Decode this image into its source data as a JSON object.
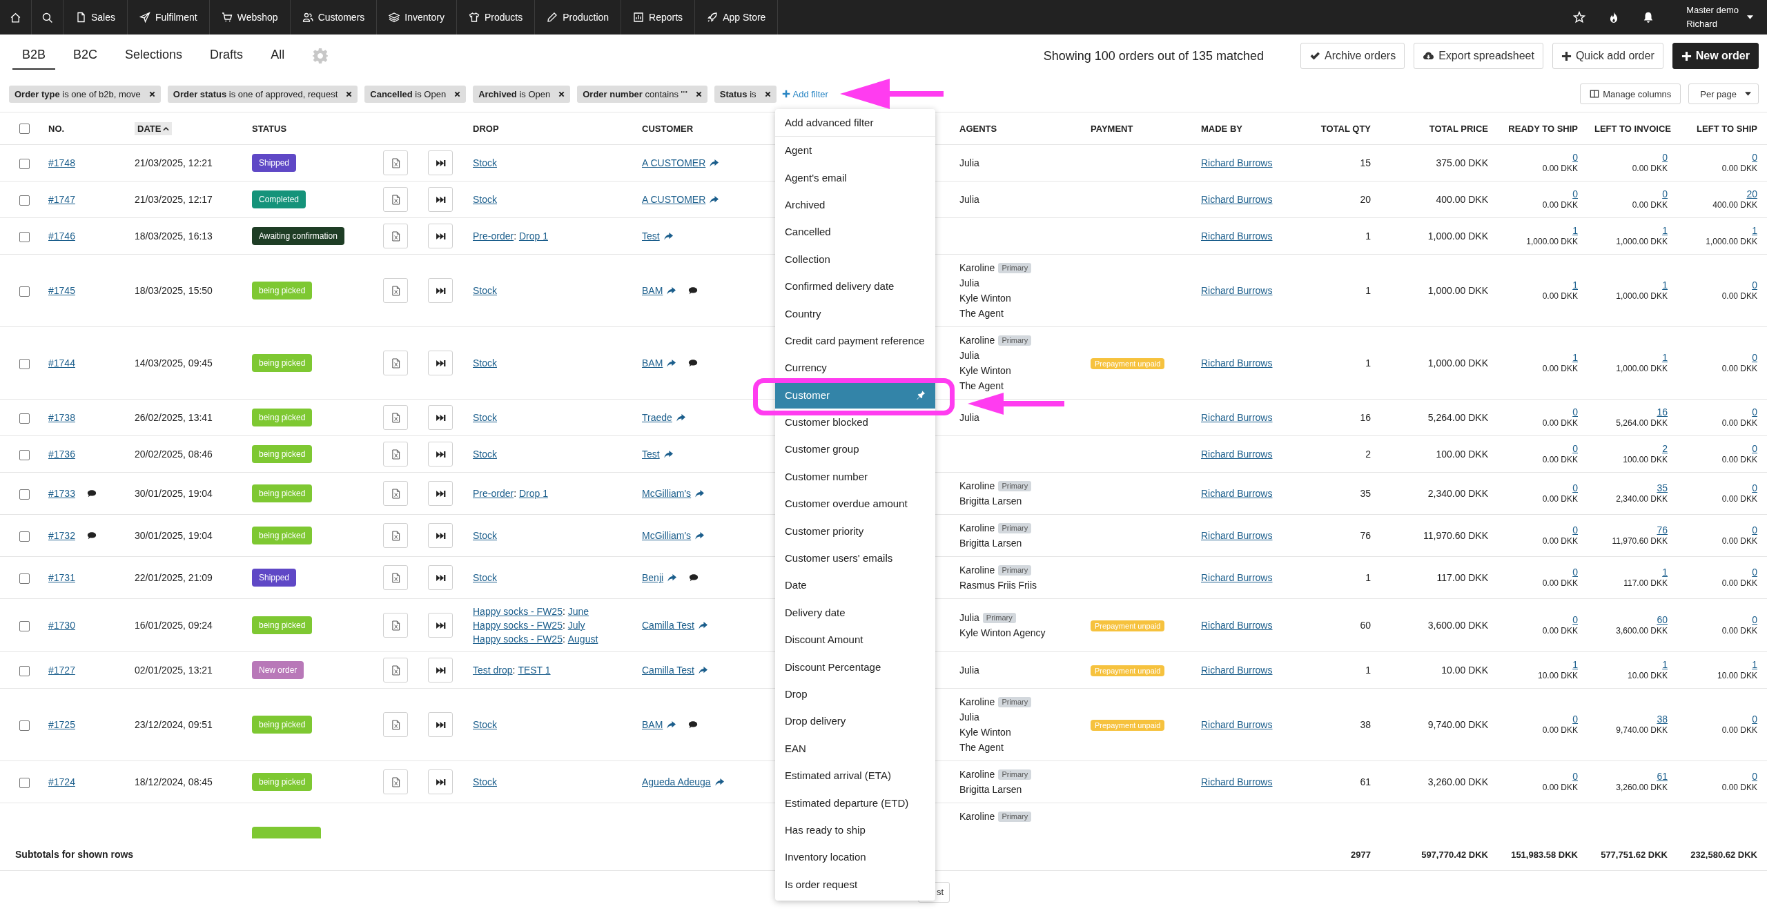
{
  "nav": {
    "items": [
      {
        "label": "Sales"
      },
      {
        "label": "Fulfilment"
      },
      {
        "label": "Webshop"
      },
      {
        "label": "Customers"
      },
      {
        "label": "Inventory"
      },
      {
        "label": "Products"
      },
      {
        "label": "Production"
      },
      {
        "label": "Reports"
      },
      {
        "label": "App Store"
      }
    ],
    "user": {
      "account": "Master demo",
      "name": "Richard"
    }
  },
  "tabs": [
    {
      "label": "B2B",
      "selected": true
    },
    {
      "label": "B2C",
      "selected": false
    },
    {
      "label": "Selections",
      "selected": false
    },
    {
      "label": "Drafts",
      "selected": false
    },
    {
      "label": "All",
      "selected": false
    }
  ],
  "summary": "Showing 100 orders out of 135 matched",
  "actions": [
    {
      "label": "Archive orders",
      "kind": "archive"
    },
    {
      "label": "Export spreadsheet",
      "kind": "export"
    },
    {
      "label": "Quick add order",
      "kind": "quick"
    },
    {
      "label": "New order",
      "kind": "new"
    }
  ],
  "filters": [
    {
      "text": "**Order type** is one of b2b, move"
    },
    {
      "text": "**Order status** is one of approved, request"
    },
    {
      "text": "**Cancelled** is Open"
    },
    {
      "text": "**Archived** is Open"
    },
    {
      "text": "**Order number** contains \"\""
    },
    {
      "text": "**Status** is"
    }
  ],
  "add_filter": "Add filter",
  "manage_columns": "Manage columns",
  "per_page": "Per page",
  "filter_menu": {
    "header": "Add advanced filter",
    "items": [
      {
        "label": "Agent",
        "selected": false
      },
      {
        "label": "Agent's email",
        "selected": false
      },
      {
        "label": "Archived",
        "selected": false
      },
      {
        "label": "Cancelled",
        "selected": false
      },
      {
        "label": "Collection",
        "selected": false
      },
      {
        "label": "Confirmed delivery date",
        "selected": false
      },
      {
        "label": "Country",
        "selected": false
      },
      {
        "label": "Credit card payment reference",
        "selected": false
      },
      {
        "label": "Currency",
        "selected": false
      },
      {
        "label": "Customer",
        "selected": true
      },
      {
        "label": "Customer blocked",
        "selected": false
      },
      {
        "label": "Customer group",
        "selected": false
      },
      {
        "label": "Customer number",
        "selected": false
      },
      {
        "label": "Customer overdue amount",
        "selected": false
      },
      {
        "label": "Customer priority",
        "selected": false
      },
      {
        "label": "Customer users' emails",
        "selected": false
      },
      {
        "label": "Date",
        "selected": false
      },
      {
        "label": "Delivery date",
        "selected": false
      },
      {
        "label": "Discount Amount",
        "selected": false
      },
      {
        "label": "Discount Percentage",
        "selected": false
      },
      {
        "label": "Drop",
        "selected": false
      },
      {
        "label": "Drop delivery",
        "selected": false
      },
      {
        "label": "EAN",
        "selected": false
      },
      {
        "label": "Estimated arrival (ETA)",
        "selected": false
      },
      {
        "label": "Estimated departure (ETD)",
        "selected": false
      },
      {
        "label": "Has ready to ship",
        "selected": false
      },
      {
        "label": "Inventory location",
        "selected": false
      },
      {
        "label": "Is order request",
        "selected": false
      }
    ]
  },
  "table": {
    "select_all_checked": false,
    "columns": [
      {
        "label": "NO.",
        "sorted": false
      },
      {
        "label": "DATE",
        "sorted": true
      },
      {
        "label": "STATUS",
        "sorted": false
      },
      {
        "label": "DROP",
        "sorted": false
      },
      {
        "label": "CUSTOMER",
        "sorted": false
      },
      {
        "label": "AGENTS",
        "sorted": false
      },
      {
        "label": "PAYMENT",
        "sorted": false
      },
      {
        "label": "MADE BY",
        "sorted": false
      },
      {
        "label": "TOTAL QTY",
        "sorted": false
      },
      {
        "label": "TOTAL PRICE",
        "sorted": false
      },
      {
        "label": "READY TO SHIP",
        "sorted": false
      },
      {
        "label": "LEFT TO INVOICE",
        "sorted": false
      },
      {
        "label": "LEFT TO SHIP",
        "sorted": false
      }
    ],
    "rows": [
      {
        "checked": false,
        "number": "#1748",
        "comment": false,
        "date": "21/03/2025, 12:21",
        "status": {
          "label": "Shipped",
          "kind": "shipped"
        },
        "drop": [
          {
            "name": "Stock"
          }
        ],
        "customer": "A CUSTOMER",
        "customer_comment": false,
        "agents": [
          {
            "name": "Julia"
          }
        ],
        "made_by": "Richard Burrows",
        "total_qty": "15",
        "total_price": "375.00 DKK",
        "ready": {
          "qty": "0",
          "amount": "0.00 DKK"
        },
        "to_invoice": {
          "qty": "0",
          "amount": "0.00 DKK"
        },
        "to_ship": {
          "qty": "0",
          "amount": "0.00 DKK"
        }
      },
      {
        "checked": false,
        "number": "#1747",
        "comment": false,
        "date": "21/03/2025, 12:17",
        "status": {
          "label": "Completed",
          "kind": "completed"
        },
        "drop": [
          {
            "name": "Stock"
          }
        ],
        "customer": "A CUSTOMER",
        "customer_comment": false,
        "agents": [
          {
            "name": "Julia"
          }
        ],
        "made_by": "Richard Burrows",
        "total_qty": "20",
        "total_price": "400.00 DKK",
        "ready": {
          "qty": "0",
          "amount": "0.00 DKK"
        },
        "to_invoice": {
          "qty": "0",
          "amount": "0.00 DKK"
        },
        "to_ship": {
          "qty": "20",
          "amount": "400.00 DKK"
        }
      },
      {
        "checked": false,
        "number": "#1746",
        "comment": false,
        "date": "18/03/2025, 16:13",
        "status": {
          "label": "Awaiting confirmation",
          "kind": "awaiting"
        },
        "drop": [
          {
            "collection": "Pre-order",
            "separator": ":",
            "name": "Drop 1"
          }
        ],
        "customer": "Test",
        "customer_comment": false,
        "made_by": "Richard Burrows",
        "total_qty": "1",
        "total_price": "1,000.00 DKK",
        "ready": {
          "qty": "1",
          "amount": "1,000.00 DKK"
        },
        "to_invoice": {
          "qty": "1",
          "amount": "1,000.00 DKK"
        },
        "to_ship": {
          "qty": "1",
          "amount": "1,000.00 DKK"
        }
      },
      {
        "checked": false,
        "number": "#1745",
        "comment": false,
        "date": "18/03/2025, 15:50",
        "status": {
          "label": "being picked",
          "kind": "picking"
        },
        "drop": [
          {
            "name": "Stock"
          }
        ],
        "customer": "BAM",
        "customer_comment": true,
        "agents": [
          {
            "name": "Karoline",
            "tag": "Primary"
          },
          {
            "name": "Julia"
          },
          {
            "name": "Kyle Winton"
          },
          {
            "name": "The Agent"
          }
        ],
        "made_by": "Richard Burrows",
        "total_qty": "1",
        "total_price": "1,000.00 DKK",
        "ready": {
          "qty": "1",
          "amount": "0.00 DKK"
        },
        "to_invoice": {
          "qty": "1",
          "amount": "1,000.00 DKK"
        },
        "to_ship": {
          "qty": "0",
          "amount": "0.00 DKK"
        }
      },
      {
        "checked": false,
        "number": "#1744",
        "comment": false,
        "date": "14/03/2025, 09:45",
        "status": {
          "label": "being picked",
          "kind": "picking"
        },
        "drop": [
          {
            "name": "Stock"
          }
        ],
        "customer": "BAM",
        "customer_comment": true,
        "agents": [
          {
            "name": "Karoline",
            "tag": "Primary"
          },
          {
            "name": "Julia"
          },
          {
            "name": "Kyle Winton"
          },
          {
            "name": "The Agent"
          }
        ],
        "payment": "Prepayment unpaid",
        "made_by": "Richard Burrows",
        "total_qty": "1",
        "total_price": "1,000.00 DKK",
        "ready": {
          "qty": "1",
          "amount": "0.00 DKK"
        },
        "to_invoice": {
          "qty": "1",
          "amount": "1,000.00 DKK"
        },
        "to_ship": {
          "qty": "0",
          "amount": "0.00 DKK"
        }
      },
      {
        "checked": false,
        "number": "#1738",
        "comment": false,
        "date": "26/02/2025, 13:41",
        "status": {
          "label": "being picked",
          "kind": "picking"
        },
        "drop": [
          {
            "name": "Stock"
          }
        ],
        "customer": "Traede",
        "customer_comment": false,
        "agents": [
          {
            "name": "Julia"
          }
        ],
        "made_by": "Richard Burrows",
        "total_qty": "16",
        "total_price": "5,264.00 DKK",
        "ready": {
          "qty": "0",
          "amount": "0.00 DKK"
        },
        "to_invoice": {
          "qty": "16",
          "amount": "5,264.00 DKK"
        },
        "to_ship": {
          "qty": "0",
          "amount": "0.00 DKK"
        }
      },
      {
        "checked": false,
        "number": "#1736",
        "comment": false,
        "date": "20/02/2025, 08:46",
        "status": {
          "label": "being picked",
          "kind": "picking"
        },
        "drop": [
          {
            "name": "Stock"
          }
        ],
        "customer": "Test",
        "customer_comment": false,
        "made_by": "Richard Burrows",
        "total_qty": "2",
        "total_price": "100.00 DKK",
        "ready": {
          "qty": "0",
          "amount": "0.00 DKK"
        },
        "to_invoice": {
          "qty": "2",
          "amount": "100.00 DKK"
        },
        "to_ship": {
          "qty": "0",
          "amount": "0.00 DKK"
        }
      },
      {
        "checked": false,
        "number": "#1733",
        "comment": true,
        "date": "30/01/2025, 19:04",
        "status": {
          "label": "being picked",
          "kind": "picking"
        },
        "drop": [
          {
            "collection": "Pre-order",
            "separator": ":",
            "name": "Drop 1"
          }
        ],
        "customer": "McGilliam's",
        "customer_comment": false,
        "agents": [
          {
            "name": "Karoline",
            "tag": "Primary"
          },
          {
            "name": "Brigitta Larsen"
          }
        ],
        "made_by": "Richard Burrows",
        "total_qty": "35",
        "total_price": "2,340.00 DKK",
        "ready": {
          "qty": "0",
          "amount": "0.00 DKK"
        },
        "to_invoice": {
          "qty": "35",
          "amount": "2,340.00 DKK"
        },
        "to_ship": {
          "qty": "0",
          "amount": "0.00 DKK"
        }
      },
      {
        "checked": false,
        "number": "#1732",
        "comment": true,
        "date": "30/01/2025, 19:04",
        "status": {
          "label": "being picked",
          "kind": "picking"
        },
        "drop": [
          {
            "name": "Stock"
          }
        ],
        "customer": "McGilliam's",
        "customer_comment": false,
        "agents": [
          {
            "name": "Karoline",
            "tag": "Primary"
          },
          {
            "name": "Brigitta Larsen"
          }
        ],
        "made_by": "Richard Burrows",
        "total_qty": "76",
        "total_price": "11,970.60 DKK",
        "ready": {
          "qty": "0",
          "amount": "0.00 DKK"
        },
        "to_invoice": {
          "qty": "76",
          "amount": "11,970.60 DKK"
        },
        "to_ship": {
          "qty": "0",
          "amount": "0.00 DKK"
        }
      },
      {
        "checked": false,
        "number": "#1731",
        "comment": false,
        "date": "22/01/2025, 21:09",
        "status": {
          "label": "Shipped",
          "kind": "shipped"
        },
        "drop": [
          {
            "name": "Stock"
          }
        ],
        "customer": "Benji",
        "customer_comment": true,
        "agents": [
          {
            "name": "Karoline",
            "tag": "Primary"
          },
          {
            "name": "Rasmus Friis Friis"
          }
        ],
        "made_by": "Richard Burrows",
        "total_qty": "1",
        "total_price": "117.00 DKK",
        "ready": {
          "qty": "0",
          "amount": "0.00 DKK"
        },
        "to_invoice": {
          "qty": "1",
          "amount": "117.00 DKK"
        },
        "to_ship": {
          "qty": "0",
          "amount": "0.00 DKK"
        }
      },
      {
        "checked": false,
        "number": "#1730",
        "comment": false,
        "date": "16/01/2025, 09:24",
        "status": {
          "label": "being picked",
          "kind": "picking"
        },
        "drop": [
          {
            "collection": "Happy socks - FW25",
            "separator": ":",
            "name": "June"
          },
          {
            "collection": "Happy socks - FW25",
            "separator": ":",
            "name": "July"
          },
          {
            "collection": "Happy socks - FW25",
            "separator": ":",
            "name": "August"
          }
        ],
        "customer": "Camilla Test",
        "customer_comment": false,
        "agents": [
          {
            "name": "Julia",
            "tag": "Primary"
          },
          {
            "name": "Kyle Winton Agency"
          }
        ],
        "payment": "Prepayment unpaid",
        "made_by": "Richard Burrows",
        "total_qty": "60",
        "total_price": "3,600.00 DKK",
        "ready": {
          "qty": "0",
          "amount": "0.00 DKK"
        },
        "to_invoice": {
          "qty": "60",
          "amount": "3,600.00 DKK"
        },
        "to_ship": {
          "qty": "0",
          "amount": "0.00 DKK"
        }
      },
      {
        "checked": false,
        "number": "#1727",
        "comment": false,
        "date": "02/01/2025, 13:21",
        "status": {
          "label": "New order",
          "kind": "new"
        },
        "drop": [
          {
            "collection": "Test drop",
            "separator": ":",
            "name": "TEST 1"
          }
        ],
        "customer": "Camilla Test",
        "customer_comment": false,
        "agents": [
          {
            "name": "Julia"
          }
        ],
        "payment": "Prepayment unpaid",
        "made_by": "Richard Burrows",
        "total_qty": "1",
        "total_price": "10.00 DKK",
        "ready": {
          "qty": "1",
          "amount": "10.00 DKK"
        },
        "to_invoice": {
          "qty": "1",
          "amount": "10.00 DKK"
        },
        "to_ship": {
          "qty": "1",
          "amount": "10.00 DKK"
        }
      },
      {
        "checked": false,
        "number": "#1725",
        "comment": false,
        "date": "23/12/2024, 09:51",
        "status": {
          "label": "being picked",
          "kind": "picking"
        },
        "drop": [
          {
            "name": "Stock"
          }
        ],
        "customer": "BAM",
        "customer_comment": true,
        "agents": [
          {
            "name": "Karoline",
            "tag": "Primary"
          },
          {
            "name": "Julia"
          },
          {
            "name": "Kyle Winton"
          },
          {
            "name": "The Agent"
          }
        ],
        "payment": "Prepayment unpaid",
        "made_by": "Richard Burrows",
        "total_qty": "38",
        "total_price": "9,740.00 DKK",
        "ready": {
          "qty": "0",
          "amount": "0.00 DKK"
        },
        "to_invoice": {
          "qty": "38",
          "amount": "9,740.00 DKK"
        },
        "to_ship": {
          "qty": "0",
          "amount": "0.00 DKK"
        }
      },
      {
        "checked": false,
        "number": "#1724",
        "comment": false,
        "date": "18/12/2024, 08:45",
        "status": {
          "label": "being picked",
          "kind": "picking"
        },
        "drop": [
          {
            "name": "Stock"
          }
        ],
        "customer": "Agueda Adeuga",
        "customer_comment": false,
        "agents": [
          {
            "name": "Karoline",
            "tag": "Primary"
          },
          {
            "name": "Brigitta Larsen"
          }
        ],
        "made_by": "Richard Burrows",
        "total_qty": "61",
        "total_price": "3,260.00 DKK",
        "ready": {
          "qty": "0",
          "amount": "0.00 DKK"
        },
        "to_invoice": {
          "qty": "61",
          "amount": "3,260.00 DKK"
        },
        "to_ship": {
          "qty": "0",
          "amount": "0.00 DKK"
        }
      }
    ],
    "partial_row": {
      "status": {
        "kind": "picking"
      },
      "agents": [
        {
          "name": "Karoline",
          "tag": "Primary"
        }
      ]
    },
    "subtotals": {
      "label": "Subtotals for shown rows",
      "total_qty": "2977",
      "total_price": "597,770.42 DKK",
      "ready": "151,983.58 DKK",
      "to_invoice": "577,751.62 DKK",
      "to_ship": "232,580.62 DKK"
    }
  },
  "pager": {
    "last": "st"
  }
}
